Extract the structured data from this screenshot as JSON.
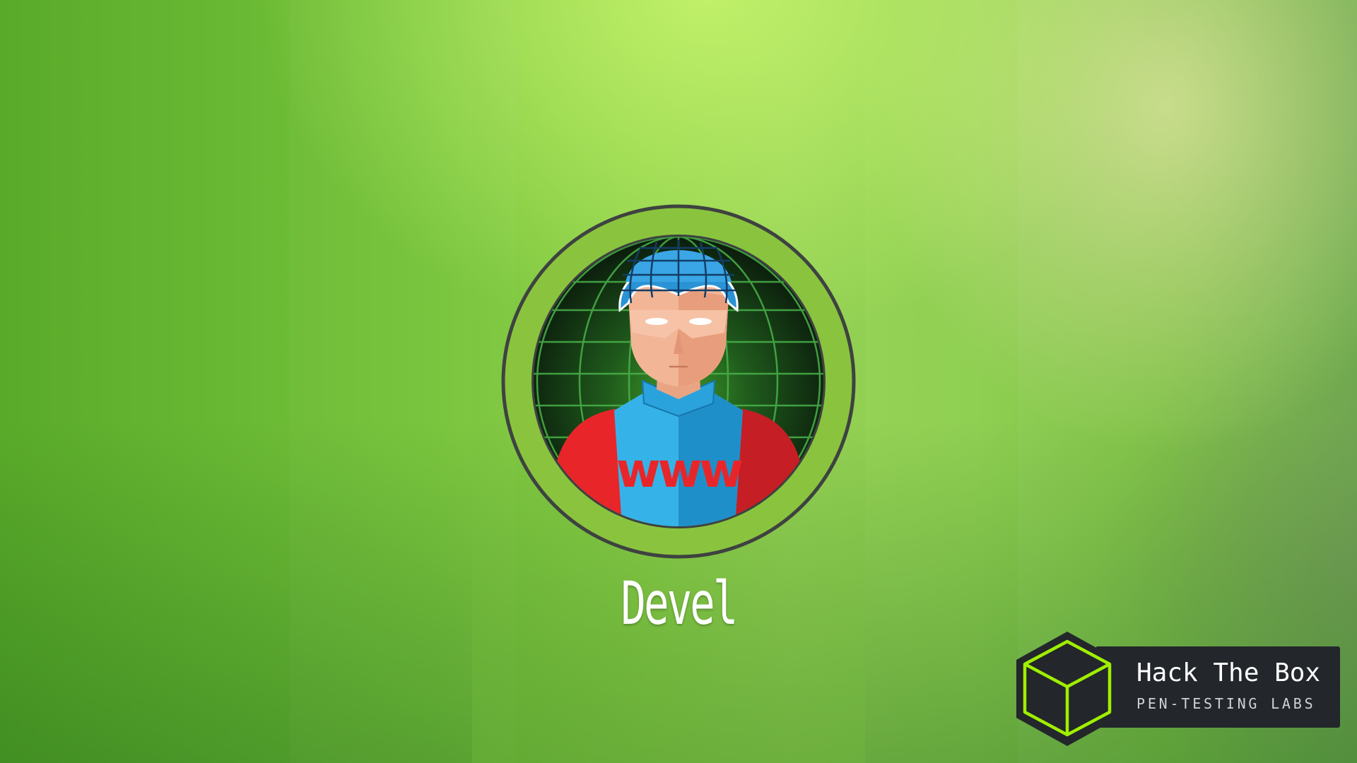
{
  "machine": {
    "name": "Devel",
    "avatar_icon": "www-superhero-icon",
    "avatar_label": "www"
  },
  "brand": {
    "title": "Hack The Box",
    "subtitle": "PEN-TESTING LABS",
    "logo_icon": "hack-the-box-cube-icon"
  },
  "colors": {
    "ring": "#8ac43e",
    "ring_outline": "#3e4240",
    "brand_green": "#9fef00",
    "badge_bg": "#23262b"
  }
}
